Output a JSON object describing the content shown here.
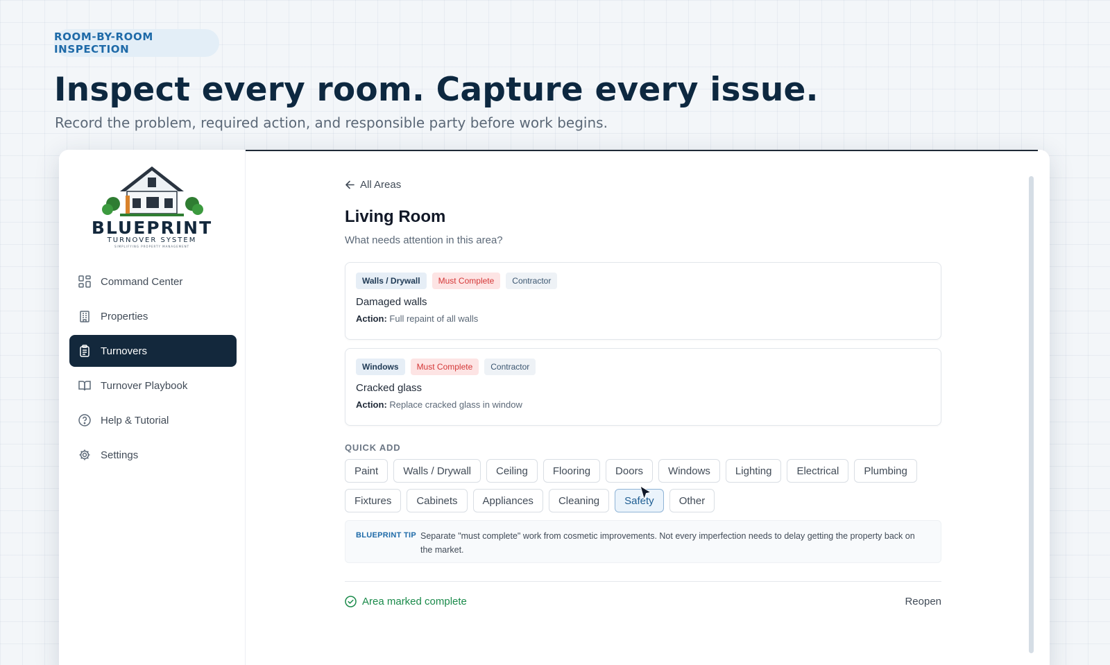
{
  "hero": {
    "eyebrow": "ROOM-BY-ROOM INSPECTION",
    "title": "Inspect every room. Capture every issue.",
    "subtitle": "Record the problem, required action, and responsible party before work begins."
  },
  "brand": {
    "name": "BLUEPRINT",
    "tagline": "TURNOVER SYSTEM",
    "small_tagline": "SIMPLIFYING PROPERTY MANAGEMENT",
    "color_navy": "#13283c"
  },
  "sidebar": {
    "items": [
      {
        "label": "Command Center",
        "icon": "grid-icon",
        "active": false
      },
      {
        "label": "Properties",
        "icon": "building-icon",
        "active": false
      },
      {
        "label": "Turnovers",
        "icon": "clipboard-icon",
        "active": true
      },
      {
        "label": "Turnover Playbook",
        "icon": "book-icon",
        "active": false
      },
      {
        "label": "Help & Tutorial",
        "icon": "help-circle-icon",
        "active": false
      },
      {
        "label": "Settings",
        "icon": "gear-icon",
        "active": false
      }
    ]
  },
  "main": {
    "back_label": "All Areas",
    "room_title": "Living Room",
    "room_subtitle": "What needs attention in this area?",
    "issues": [
      {
        "category": "Walls / Drywall",
        "priority": "Must Complete",
        "party": "Contractor",
        "title": "Damaged walls",
        "action_label": "Action:",
        "action": "Full repaint of all walls"
      },
      {
        "category": "Windows",
        "priority": "Must Complete",
        "party": "Contractor",
        "title": "Cracked glass",
        "action_label": "Action:",
        "action": "Replace cracked glass in window"
      }
    ],
    "quick_add_label": "QUICK ADD",
    "quick_add_row1": [
      "Paint",
      "Walls / Drywall",
      "Ceiling",
      "Flooring",
      "Doors",
      "Windows",
      "Lighting",
      "Electrical",
      "Plumbing"
    ],
    "quick_add_row2": [
      "Fixtures",
      "Cabinets",
      "Appliances",
      "Cleaning",
      "Safety",
      "Other"
    ],
    "tip_label": "BLUEPRINT TIP",
    "tip_text": "Separate \"must complete\" work from cosmetic improvements. Not every imperfection needs to delay getting the property back on the market.",
    "complete_label": "Area marked complete",
    "reopen_label": "Reopen"
  }
}
